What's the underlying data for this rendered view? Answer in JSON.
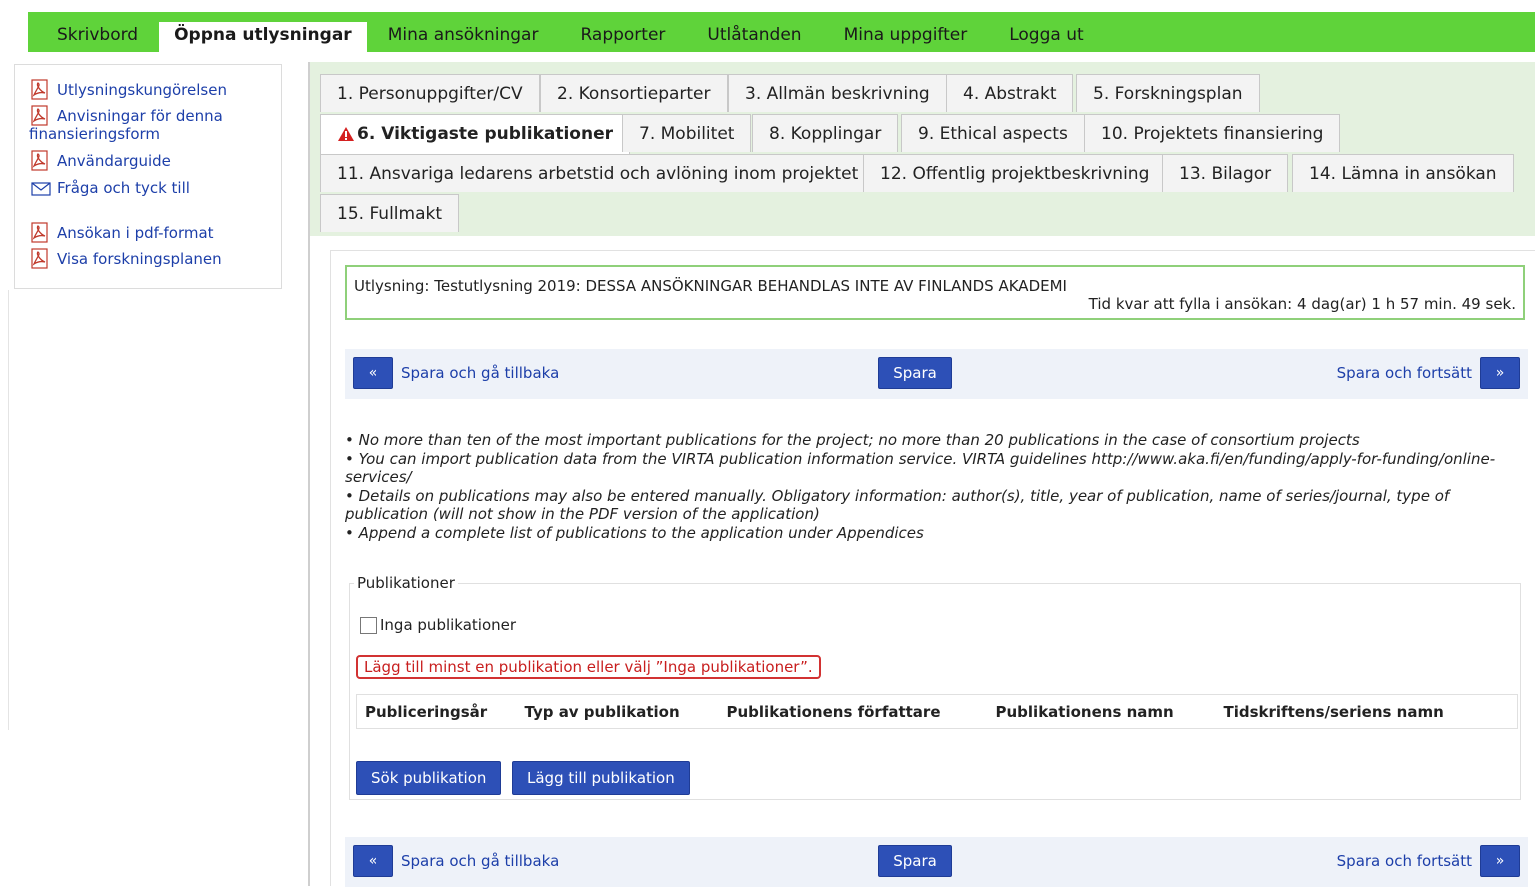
{
  "topnav": {
    "items": [
      "Skrivbord",
      "Öppna utlysningar",
      "Mina ansökningar",
      "Rapporter",
      "Utlåtanden",
      "Mina uppgifter",
      "Logga ut"
    ],
    "active_index": 1
  },
  "sidebar": {
    "links": [
      {
        "label": "Utlysningskungörelsen",
        "icon": "pdf-icon"
      },
      {
        "label": "Anvisningar för denna finansieringsform",
        "icon": "pdf-icon"
      },
      {
        "label": "Användarguide",
        "icon": "pdf-icon"
      },
      {
        "label": "Fråga och tyck till",
        "icon": "mail-icon"
      },
      {
        "label": "Ansökan i pdf-format",
        "icon": "pdf-icon"
      },
      {
        "label": "Visa forskningsplanen",
        "icon": "pdf-icon"
      }
    ]
  },
  "tabs": [
    "1. Personuppgifter/CV",
    "2. Konsortieparter",
    "3. Allmän beskrivning",
    "4. Abstrakt",
    "5. Forskningsplan",
    "6. Viktigaste publikationer",
    "7. Mobilitet",
    "8. Kopplingar",
    "9. Ethical aspects",
    "10. Projektets finansiering",
    "11. Ansvariga ledarens arbetstid och avlöning inom projektet",
    "12. Offentlig projektbeskrivning",
    "13. Bilagor",
    "14. Lämna in ansökan",
    "15. Fullmakt"
  ],
  "call": {
    "title": "Utlysning: Testutlysning 2019: DESSA ANSÖKNINGAR BEHANDLAS INTE AV FINLANDS AKADEMI",
    "time_left": "Tid kvar att fylla i ansökan: 4 dag(ar) 1 h 57 min. 49 sek."
  },
  "savebar": {
    "back_arrow": "«",
    "back_label": "Spara och gå tillbaka",
    "save_label": "Spara",
    "next_label": "Spara och fortsätt",
    "next_arrow": "»"
  },
  "instructions": [
    "• No more than ten of the most important publications for the project; no more than 20 publications in the case of consortium projects",
    "• You can import publication data from the VIRTA publication information service. VIRTA guidelines http://www.aka.fi/en/funding/apply-for-funding/online-services/",
    "• Details on publications may also be entered manually. Obligatory information: author(s), title, year of publication, name of series/journal, type of publication (will not show in the PDF version of the application)",
    "• Append a complete list of publications to the application under Appendices"
  ],
  "publications": {
    "legend": "Publikationer",
    "no_pub_label": "Inga publikationer",
    "error": "Lägg till minst en publikation eller välj ”Inga publikationer”.",
    "columns": [
      "Publiceringsår",
      "Typ av publikation",
      "Publikationens författare",
      "Publikationens namn",
      "Tidskriftens/seriens namn"
    ],
    "search_button": "Sök publikation",
    "add_button": "Lägg till publikation"
  },
  "colors": {
    "nav_green": "#5fd33a",
    "tab_bg": "#e4f1df",
    "button_blue": "#2d50b7",
    "link_blue": "#1d3fa9",
    "error_red": "#c81e1e"
  }
}
